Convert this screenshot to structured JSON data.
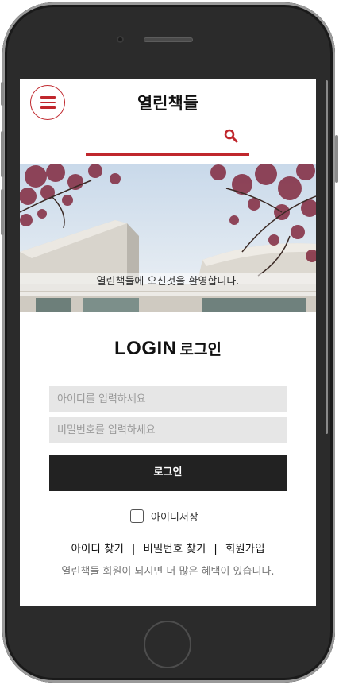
{
  "header": {
    "logo": "열린책들",
    "menu_icon": "hamburger-icon",
    "search_icon": "search-icon"
  },
  "hero": {
    "caption": "열린책들에 오신것을 환영합니다."
  },
  "login": {
    "title_en": "LOGIN",
    "title_ko": "로그인",
    "id_placeholder": "아이디를 입력하세요",
    "pw_placeholder": "비밀번호를 입력하세요",
    "submit_label": "로그인",
    "save_id_label": "아이디저장"
  },
  "links": {
    "find_id": "아이디 찾기",
    "find_pw": "비밀번호 찾기",
    "signup": "회원가입",
    "separator": "|"
  },
  "benefit_text": "열린책들 회원이 되시면 더 많은 혜택이 있습니다.",
  "colors": {
    "accent": "#c0272d",
    "button": "#222222",
    "field_bg": "#e6e6e6"
  }
}
